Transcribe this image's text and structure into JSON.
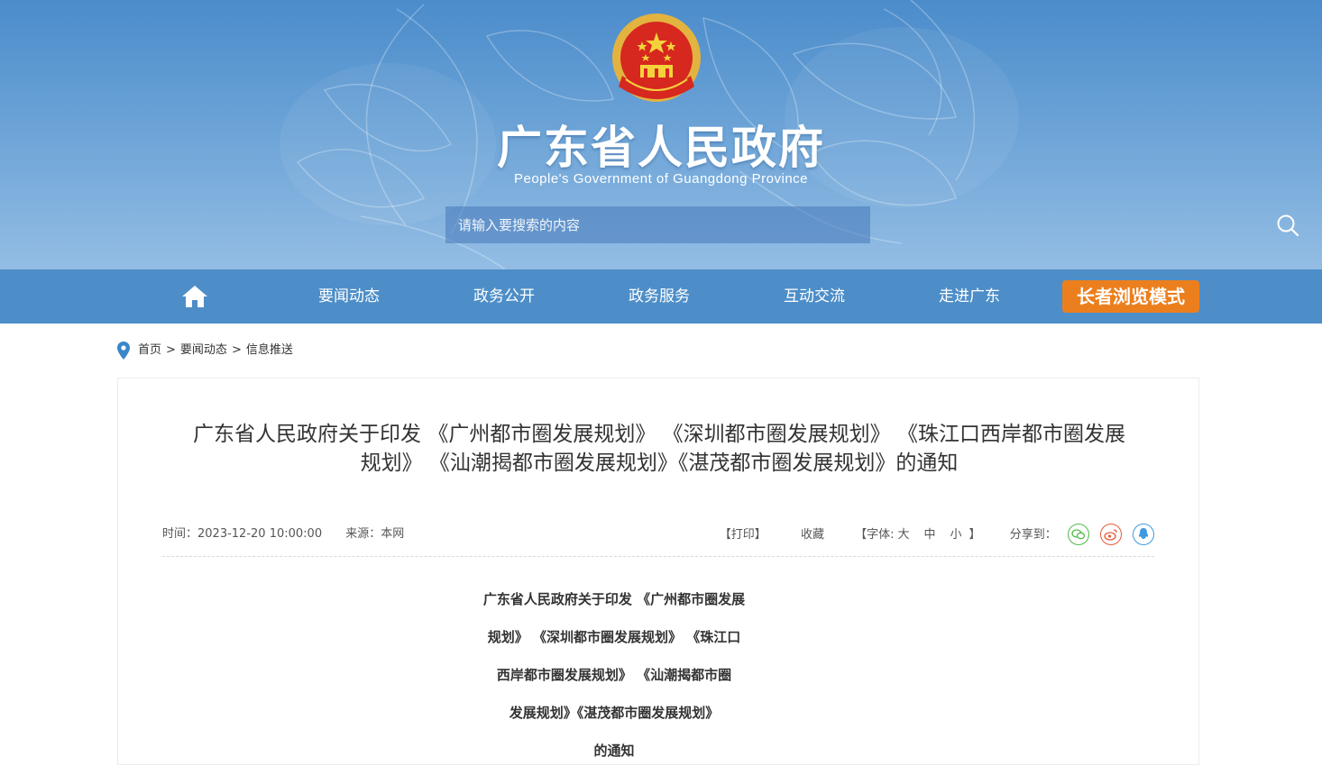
{
  "header": {
    "site_title": "广东省人民政府",
    "site_subtitle": "People's Government of Guangdong Province",
    "search_placeholder": "请输入要搜索的内容"
  },
  "nav": {
    "items": [
      {
        "label": "要闻动态"
      },
      {
        "label": "政务公开"
      },
      {
        "label": "政务服务"
      },
      {
        "label": "互动交流"
      },
      {
        "label": "走进广东"
      }
    ],
    "elder_mode_label": "长者浏览模式"
  },
  "breadcrumb": {
    "home": "首页",
    "level1": "要闻动态",
    "level2": "信息推送",
    "separator": ">"
  },
  "article": {
    "title_line1": "广东省人民政府关于印发 《广州都市圈发展规划》 《深圳都市圈发展规划》 《珠江口西岸都市圈发展",
    "title_line2": "规划》 《汕潮揭都市圈发展规划》《湛茂都市圈发展规划》的通知",
    "time_label": "时间：",
    "time_value": "2023-12-20 10:00:00",
    "source_label": "来源：",
    "source_value": "本网",
    "print_label": "【打印】",
    "favorite_label": "收藏",
    "font_label": "【字体:",
    "font_large": "大",
    "font_medium": "中",
    "font_small": "小",
    "font_close": "】",
    "share_label": "分享到：",
    "body_title_lines": [
      "广东省人民政府关于印发 《广州都市圈发展",
      "规划》 《深圳都市圈发展规划》 《珠江口",
      "西岸都市圈发展规划》 《汕潮揭都市圈",
      "发展规划》《湛茂都市圈发展规划》",
      "的通知"
    ]
  },
  "colors": {
    "nav_bg": "#4d8ec8",
    "elder_button": "#ec7f1d",
    "wechat": "#52b94a",
    "weibo": "#e6593a",
    "qq": "#3d9ae0"
  }
}
